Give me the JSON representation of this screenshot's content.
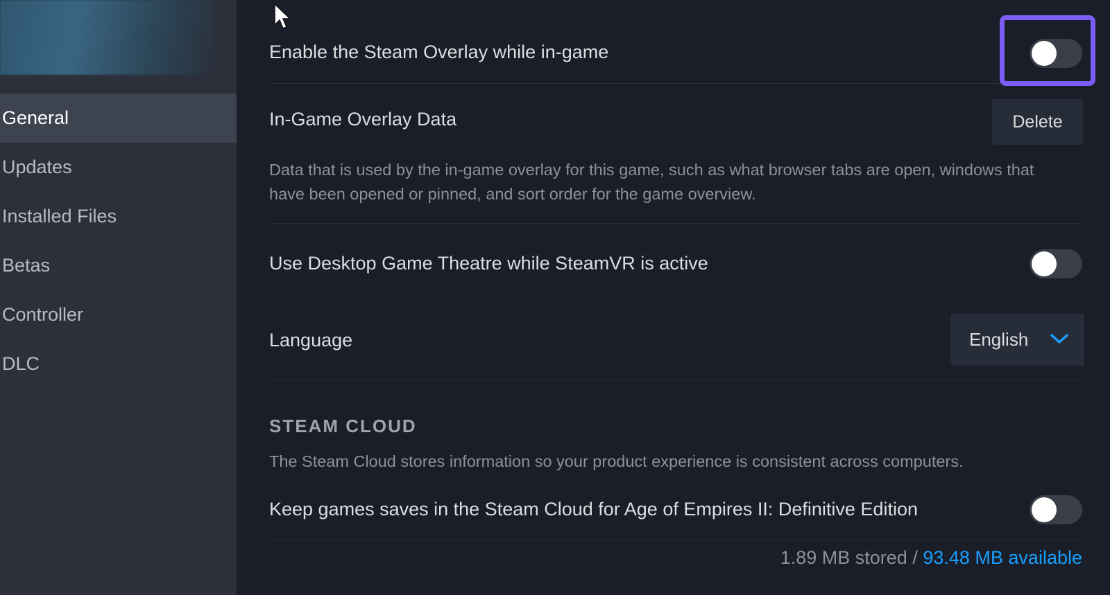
{
  "sidebar": {
    "items": [
      {
        "label": "General",
        "active": true
      },
      {
        "label": "Updates"
      },
      {
        "label": "Installed Files"
      },
      {
        "label": "Betas"
      },
      {
        "label": "Controller"
      },
      {
        "label": "DLC"
      }
    ]
  },
  "settings": {
    "overlay": {
      "label": "Enable the Steam Overlay while in-game",
      "enabled": false
    },
    "overlay_data": {
      "label": "In-Game Overlay Data",
      "button_label": "Delete",
      "description": "Data that is used by the in-game overlay for this game, such as what browser tabs are open, windows that have been opened or pinned, and sort order for the game overview."
    },
    "theatre": {
      "label": "Use Desktop Game Theatre while SteamVR is active",
      "enabled": false
    },
    "language": {
      "label": "Language",
      "value": "English"
    }
  },
  "steam_cloud": {
    "title": "STEAM CLOUD",
    "description": "The Steam Cloud stores information so your product experience is consistent across computers.",
    "keep_saves": {
      "label": "Keep games saves in the Steam Cloud for Age of Empires II: Definitive Edition",
      "enabled": false
    },
    "stored": "1.89 MB stored /",
    "available": "93.48 MB available"
  },
  "colors": {
    "background": "#191e29",
    "sidebar": "#2b303b",
    "highlight": "#7b5cf5",
    "link": "#1a9fff"
  },
  "icons": {
    "cursor": "mouse-pointer",
    "dropdown": "chevron-down"
  }
}
